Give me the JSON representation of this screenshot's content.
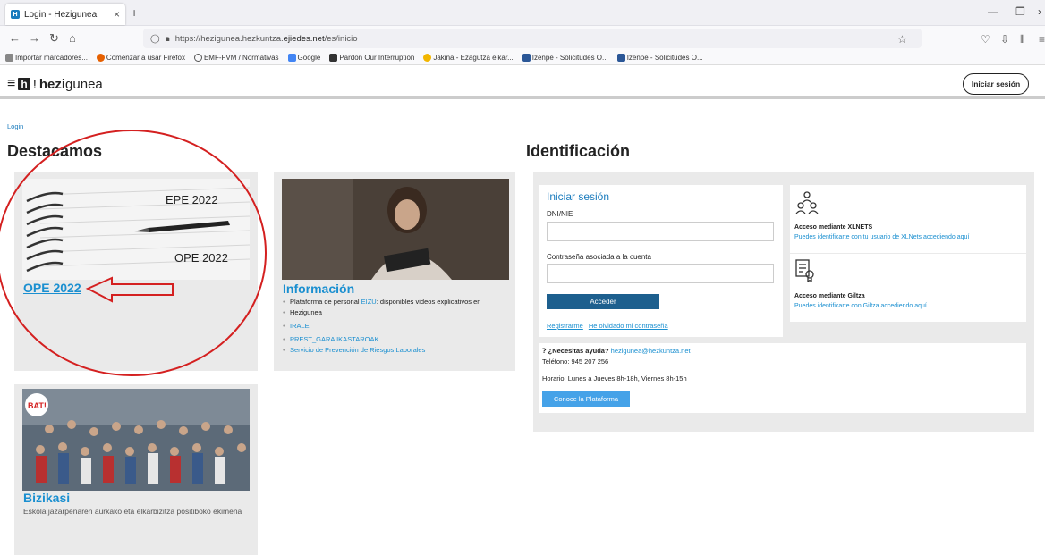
{
  "browser": {
    "tab_title": "Login - Hezigunea",
    "favicon_letter": "H",
    "tab_close": "×",
    "new_tab": "+",
    "url_prefix": "https://hezigunea.hezkuntza.",
    "url_domain": "ejiedes.net",
    "url_suffix": "/es/inicio",
    "bookmarks": [
      "Importar marcadores...",
      "Comenzar a usar Firefox",
      "EMF-FVM / Normativas",
      "Google",
      "Pardon Our Interruption",
      "Jakina - Ezagutza elkar...",
      "Izenpe - Solicitudes O...",
      "Izenpe - Solicitudes O..."
    ]
  },
  "header": {
    "logo_box": "h",
    "logo_excl": "!",
    "logo_name": "hezi",
    "logo_name2": "gunea",
    "login_button": "Iniciar sesión"
  },
  "breadcrumb": "Login",
  "left": {
    "heading": "Destacamos",
    "card1": {
      "title": "OPE 2022",
      "img_text_1": "EPE 2022",
      "img_text_2": "OPE 2022"
    },
    "card2": {
      "title": "Información",
      "items": [
        {
          "pre": "Plataforma de personal ",
          "link": "EIZU",
          "post": ": disponibles videos explicativos en"
        },
        {
          "pre": "Hezigunea",
          "link": "",
          "post": ""
        },
        {
          "pre": "",
          "link": "IRALE",
          "post": ""
        },
        {
          "pre": "",
          "link": "PREST_GARA IKASTAROAK",
          "post": ""
        },
        {
          "pre": "",
          "link": "Servicio de Prevención de Riesgos Laborales",
          "post": ""
        }
      ]
    },
    "card3": {
      "title": "Bizikasi",
      "badge": "BAT!",
      "desc": "Eskola jazarpenaren aurkako eta elkarbizitza positiboko ekimena"
    }
  },
  "right": {
    "heading": "Identificación",
    "login": {
      "title": "Iniciar sesión",
      "dni_label": "DNI/NIE",
      "pass_label": "Contraseña asociada a la cuenta",
      "submit": "Acceder",
      "register": "Registrarme",
      "forgot": "He olvidado mi contraseña"
    },
    "xlnets": {
      "title": "Acceso mediante XLNETS",
      "desc": "Puedes identificarte con tu usuario de XLNets accediendo aquí"
    },
    "giltza": {
      "title": "Acceso mediante Giltza",
      "desc": "Puedes identificarte con Giltza accediendo aquí"
    },
    "help": {
      "q": "¿Necesitas ayuda?",
      "email": "hezigunea@hezkuntza.net",
      "phone": "Teléfono: 945 207 256",
      "hours": "Horario: Lunes a Jueves 8h-18h, Viernes 8h-15h",
      "platform_button": "Conoce la Plataforma"
    }
  },
  "colors": {
    "accent": "#1a8fd0",
    "button_dark": "#1d5f8e",
    "annotation": "#d42020"
  }
}
